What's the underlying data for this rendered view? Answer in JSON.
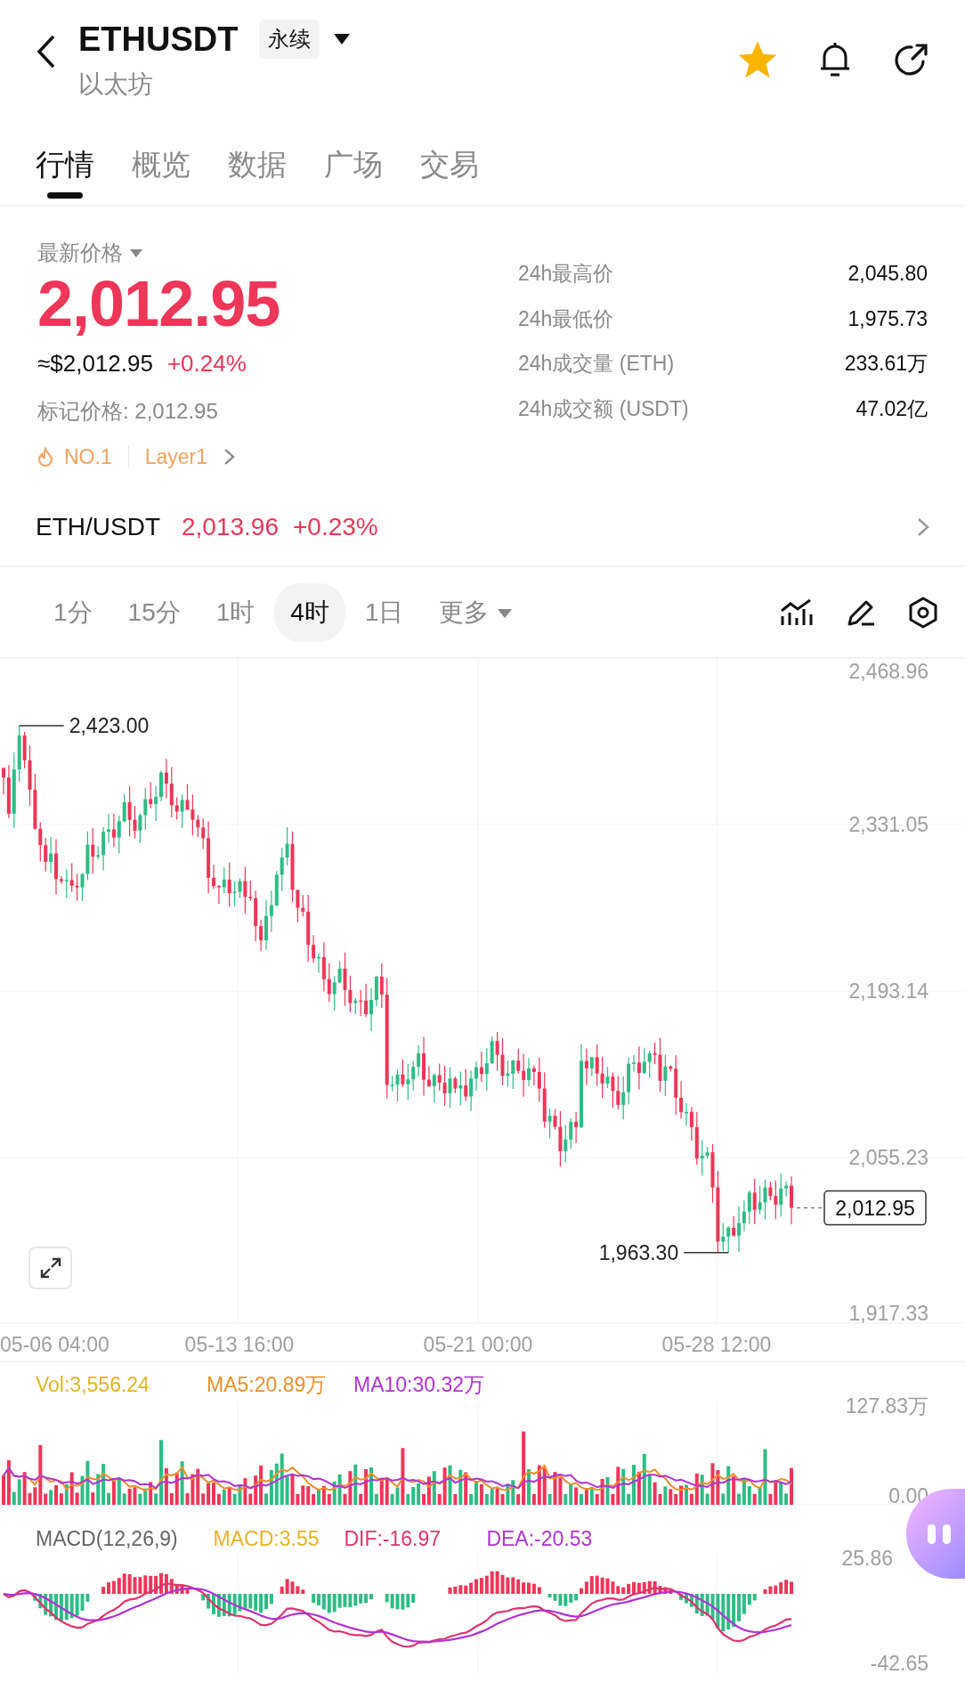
{
  "header": {
    "symbol": "ETHUSDT",
    "contract_type": "永续",
    "name": "以太坊",
    "favorited": true
  },
  "tabs": [
    {
      "label": "行情",
      "selected": true
    },
    {
      "label": "概览",
      "selected": false
    },
    {
      "label": "数据",
      "selected": false
    },
    {
      "label": "广场",
      "selected": false
    },
    {
      "label": "交易",
      "selected": false
    }
  ],
  "price": {
    "label": "最新价格",
    "last": "2,012.95",
    "usd": "≈$2,012.95",
    "change": "+0.24%",
    "mark_price": "标记价格: 2,012.95",
    "tags": [
      "NO.1",
      "Layer1"
    ]
  },
  "stats": [
    {
      "label": "24h最高价",
      "value": "2,045.80"
    },
    {
      "label": "24h最低价",
      "value": "1,975.73"
    },
    {
      "label": "24h成交量 (ETH)",
      "value": "233.61万"
    },
    {
      "label": "24h成交额 (USDT)",
      "value": "47.02亿"
    }
  ],
  "spot": {
    "pair": "ETH/USDT",
    "price": "2,013.96",
    "change": "+0.23%"
  },
  "intervals": [
    {
      "label": "1分",
      "selected": false,
      "kind": "plain"
    },
    {
      "label": "15分",
      "selected": false,
      "kind": "plain"
    },
    {
      "label": "1时",
      "selected": false,
      "kind": "plain"
    },
    {
      "label": "4时",
      "selected": true,
      "kind": "plain"
    },
    {
      "label": "1日",
      "selected": false,
      "kind": "plain"
    },
    {
      "label": "更多",
      "selected": false,
      "kind": "dropdown"
    }
  ],
  "chart": {
    "price_axis": [
      "2,468.96",
      "2,331.05",
      "2,193.14",
      "2,055.23",
      "1,917.33"
    ],
    "time_axis": [
      "05-06 04:00",
      "05-13 16:00",
      "05-21 00:00",
      "05-28 12:00"
    ],
    "high_marker": "2,423.00",
    "low_marker": "1,963.30",
    "last_price_tag": "2,012.95"
  },
  "volume": {
    "legend": [
      {
        "text": "Vol:3,556.24",
        "color": "#e6b422"
      },
      {
        "text": "MA5:20.89万",
        "color": "#ef8f2a"
      },
      {
        "text": "MA10:30.32万",
        "color": "#b133d4"
      }
    ],
    "axis": [
      "127.83万",
      "0.00"
    ]
  },
  "macd": {
    "legend": [
      {
        "text": "MACD(12,26,9)",
        "color": "#666666"
      },
      {
        "text": "MACD:3.55",
        "color": "#e6b422"
      },
      {
        "text": "DIF:-16.97",
        "color": "#e0336e"
      },
      {
        "text": "DEA:-20.53",
        "color": "#b133d4"
      }
    ],
    "axis": [
      "25.86",
      "-42.65"
    ]
  }
}
